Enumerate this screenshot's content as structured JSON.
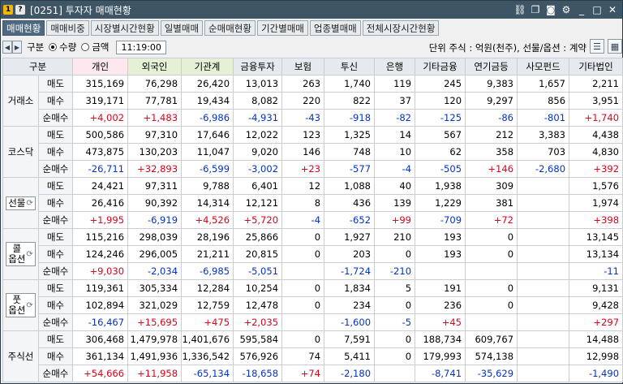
{
  "window": {
    "title": "[0251] 투자자 매매현황"
  },
  "tabs": [
    "매매현황",
    "매매비중",
    "시장별시간현황",
    "일별매매",
    "순매매현황",
    "기간별매매",
    "업종별매매",
    "전체시장시간현황"
  ],
  "toolbar": {
    "group_label": "구분",
    "radio_qty": "수량",
    "radio_amt": "금액",
    "time": "11:19:00",
    "unit": "단위 주식 : 억원(천주), 선물/옵션 : 계약"
  },
  "headers": [
    "구분",
    "개인",
    "외국인",
    "기관계",
    "금융투자",
    "보험",
    "투신",
    "은행",
    "기타금융",
    "연기금등",
    "사모펀드",
    "기타법인"
  ],
  "row_labels": [
    "매도",
    "매수",
    "순매수"
  ],
  "groups": [
    {
      "name": "거래소",
      "button": false,
      "rows": [
        [
          "315,169",
          "76,298",
          "26,420",
          "13,013",
          "263",
          "1,740",
          "119",
          "245",
          "9,383",
          "1,657",
          "2,211"
        ],
        [
          "319,171",
          "77,781",
          "19,434",
          "8,082",
          "220",
          "822",
          "37",
          "120",
          "9,297",
          "856",
          "3,951"
        ],
        [
          "+4,002",
          "+1,483",
          "-6,986",
          "-4,931",
          "-43",
          "-918",
          "-82",
          "-125",
          "-86",
          "-801",
          "+1,740"
        ]
      ]
    },
    {
      "name": "코스닥",
      "button": false,
      "rows": [
        [
          "500,586",
          "97,310",
          "17,646",
          "12,022",
          "123",
          "1,325",
          "14",
          "567",
          "212",
          "3,383",
          "4,438"
        ],
        [
          "473,875",
          "130,203",
          "11,047",
          "9,020",
          "146",
          "748",
          "10",
          "62",
          "358",
          "703",
          "4,830"
        ],
        [
          "-26,711",
          "+32,893",
          "-6,599",
          "-3,002",
          "+23",
          "-577",
          "-4",
          "-505",
          "+146",
          "-2,680",
          "+392"
        ]
      ]
    },
    {
      "name": "선물",
      "button": true,
      "rows": [
        [
          "24,421",
          "97,311",
          "9,788",
          "6,401",
          "12",
          "1,088",
          "40",
          "1,938",
          "309",
          "",
          "1,576"
        ],
        [
          "26,416",
          "90,392",
          "14,314",
          "12,121",
          "8",
          "436",
          "139",
          "1,229",
          "381",
          "",
          "1,974"
        ],
        [
          "+1,995",
          "-6,919",
          "+4,526",
          "+5,720",
          "-4",
          "-652",
          "+99",
          "-709",
          "+72",
          "",
          "+398"
        ]
      ]
    },
    {
      "name": "콜\n옵션",
      "button": true,
      "rows": [
        [
          "115,216",
          "298,039",
          "28,196",
          "25,866",
          "0",
          "1,927",
          "210",
          "193",
          "0",
          "",
          "13,145"
        ],
        [
          "124,246",
          "296,005",
          "21,211",
          "20,815",
          "0",
          "203",
          "0",
          "193",
          "0",
          "",
          "13,134"
        ],
        [
          "+9,030",
          "-2,034",
          "-6,985",
          "-5,051",
          "",
          "-1,724",
          "-210",
          "",
          "",
          "",
          "-11"
        ]
      ]
    },
    {
      "name": "풋\n옵션",
      "button": true,
      "rows": [
        [
          "119,361",
          "305,334",
          "12,284",
          "10,254",
          "0",
          "1,834",
          "5",
          "191",
          "0",
          "",
          "9,131"
        ],
        [
          "102,894",
          "321,029",
          "12,759",
          "12,478",
          "0",
          "234",
          "0",
          "236",
          "0",
          "",
          "9,428"
        ],
        [
          "-16,467",
          "+15,695",
          "+475",
          "+2,035",
          "",
          "-1,600",
          "-5",
          "+45",
          "",
          "",
          "+297"
        ]
      ]
    },
    {
      "name": "주식선",
      "button": false,
      "rows": [
        [
          "306,468",
          "1,479,978",
          "1,401,676",
          "595,584",
          "0",
          "7,591",
          "0",
          "188,734",
          "609,767",
          "",
          "14,488"
        ],
        [
          "361,134",
          "1,491,936",
          "1,336,542",
          "576,926",
          "74",
          "5,411",
          "0",
          "179,993",
          "574,138",
          "",
          "12,998"
        ],
        [
          "+54,666",
          "+11,958",
          "-65,134",
          "-18,658",
          "+74",
          "-2,180",
          "",
          "-8,741",
          "-35,629",
          "",
          "-1,490"
        ]
      ]
    }
  ]
}
